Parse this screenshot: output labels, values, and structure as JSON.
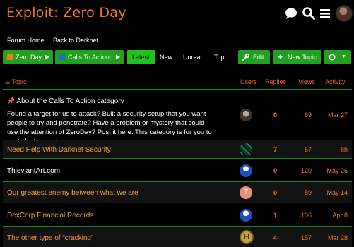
{
  "site": {
    "title": "Exploit: Zero Day"
  },
  "header_icons": [
    "chat-icon",
    "search-icon",
    "menu-icon"
  ],
  "subnav": {
    "forum_home": "Forum Home",
    "back": "Back to Darknet"
  },
  "controls": {
    "category": "Zero Day",
    "subcategory": "Calls To Action",
    "tabs": [
      "Latest",
      "New",
      "Unread",
      "Top"
    ],
    "active_tab": "Latest",
    "edit": "Edit",
    "new_topic": "New Topic"
  },
  "columns": {
    "topic": "Topic",
    "users": "Users",
    "replies": "Replies",
    "views": "Views",
    "activity": "Activity"
  },
  "pinned": {
    "title": "About the Calls To Action category",
    "excerpt": "Found a target for us to attack? Built a security setup that you want people to try and penetrate? Have a problem or mystery that could use the attention of ZeroDay? Post it here. This category is for you to post clust…",
    "read_more": "read more",
    "replies": "0",
    "views": "69",
    "activity": "Mar 27"
  },
  "topics": [
    {
      "title": "Need Help With Darknet Security",
      "replies": "7",
      "views": "57",
      "activity": "8h"
    },
    {
      "title": "ThieviantArt.com",
      "replies": "0",
      "views": "120",
      "activity": "May 26"
    },
    {
      "title": "Our greatest enemy between what we are",
      "replies": "0",
      "views": "89",
      "activity": "May 14",
      "avatar_letter": "T"
    },
    {
      "title": "DexCorp Financial Records",
      "replies": "1",
      "views": "106",
      "activity": "Apr 8"
    },
    {
      "title": "The other type of “cracking”",
      "replies": "4",
      "views": "157",
      "activity": "Mar 28",
      "avatar_letter": "H"
    }
  ],
  "colors": {
    "accent": "#f07a1a",
    "green": "#21a11e",
    "category_orange": "#f07a1a",
    "category_blue": "#1f6bc6"
  }
}
